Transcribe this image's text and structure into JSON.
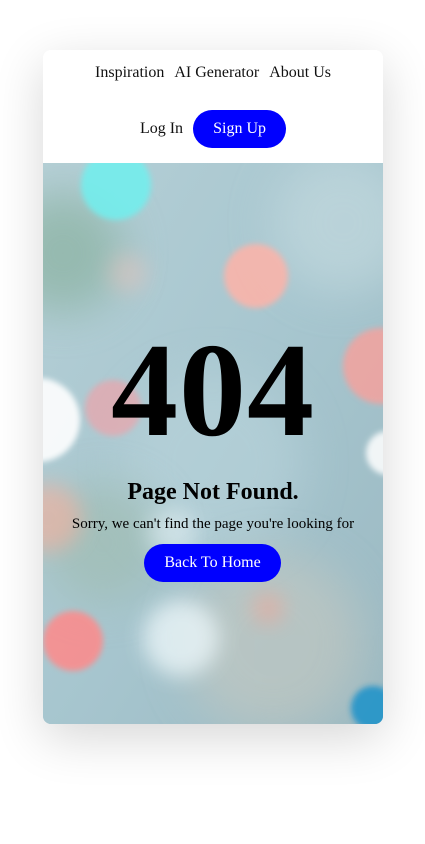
{
  "nav": {
    "links": [
      "Inspiration",
      "AI Generator",
      "About Us"
    ],
    "login_label": "Log In",
    "signup_label": "Sign Up"
  },
  "error": {
    "code": "404",
    "title": "Page Not Found.",
    "message": "Sorry, we can't find the page you're looking for",
    "home_button_label": "Back To Home"
  },
  "colors": {
    "accent": "#0000ff",
    "button_text": "#ffffff"
  }
}
